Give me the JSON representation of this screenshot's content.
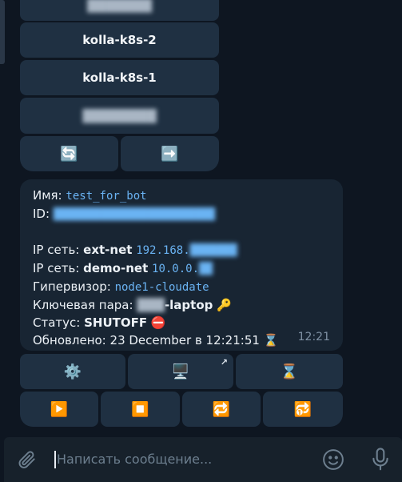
{
  "keyboard_top": {
    "server_buttons": [
      {
        "label": "kolla-k8s-2"
      },
      {
        "label": "kolla-k8s-1"
      }
    ],
    "refresh_icon": "🔄",
    "next_icon": "➡️"
  },
  "message": {
    "name_label": "Имя:",
    "name_value": "test_for_bot",
    "id_label": "ID:",
    "net1_prefix": "IP сеть:",
    "net1_name": "ext-net",
    "net1_ip": "192.168.",
    "net2_prefix": "IP сеть:",
    "net2_name": "demo-net",
    "net2_ip": "10.0.0.",
    "hypervisor_label": "Гипервизор:",
    "hypervisor_value": "node1-cloudate",
    "keypair_label": "Ключевая пара:",
    "keypair_suffix": "-laptop",
    "keypair_icon": "🔑",
    "status_label": "Статус:",
    "status_value": "SHUTOFF",
    "status_icon": "⛔",
    "updated_label": "Обновлено:",
    "updated_value": "23 December в 12:21:51",
    "updated_icon": "⌛",
    "time": "12:21"
  },
  "keyboard_bottom": {
    "row1": [
      {
        "icon": "⚙️",
        "name": "settings"
      },
      {
        "icon": "🖥️",
        "name": "console"
      },
      {
        "icon": "⌛",
        "name": "hourglass"
      }
    ],
    "link_arrow": "↗",
    "row2": [
      {
        "icon": "▶️",
        "name": "start"
      },
      {
        "icon": "⏹️",
        "name": "stop"
      },
      {
        "icon": "🔁",
        "name": "reboot"
      },
      {
        "icon": "🔂",
        "name": "hard-reboot"
      }
    ]
  },
  "composer": {
    "placeholder": "Написать сообщение..."
  }
}
